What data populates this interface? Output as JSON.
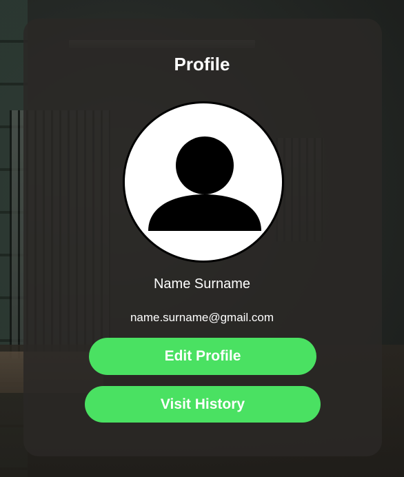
{
  "profile": {
    "title": "Profile",
    "name": "Name Surname",
    "email": "name.surname@gmail.com",
    "avatar_icon": "user-silhouette-icon"
  },
  "actions": {
    "edit_label": "Edit Profile",
    "history_label": "Visit History"
  },
  "colors": {
    "accent": "#4ae162",
    "card": "#2a2826",
    "text": "#ffffff"
  }
}
